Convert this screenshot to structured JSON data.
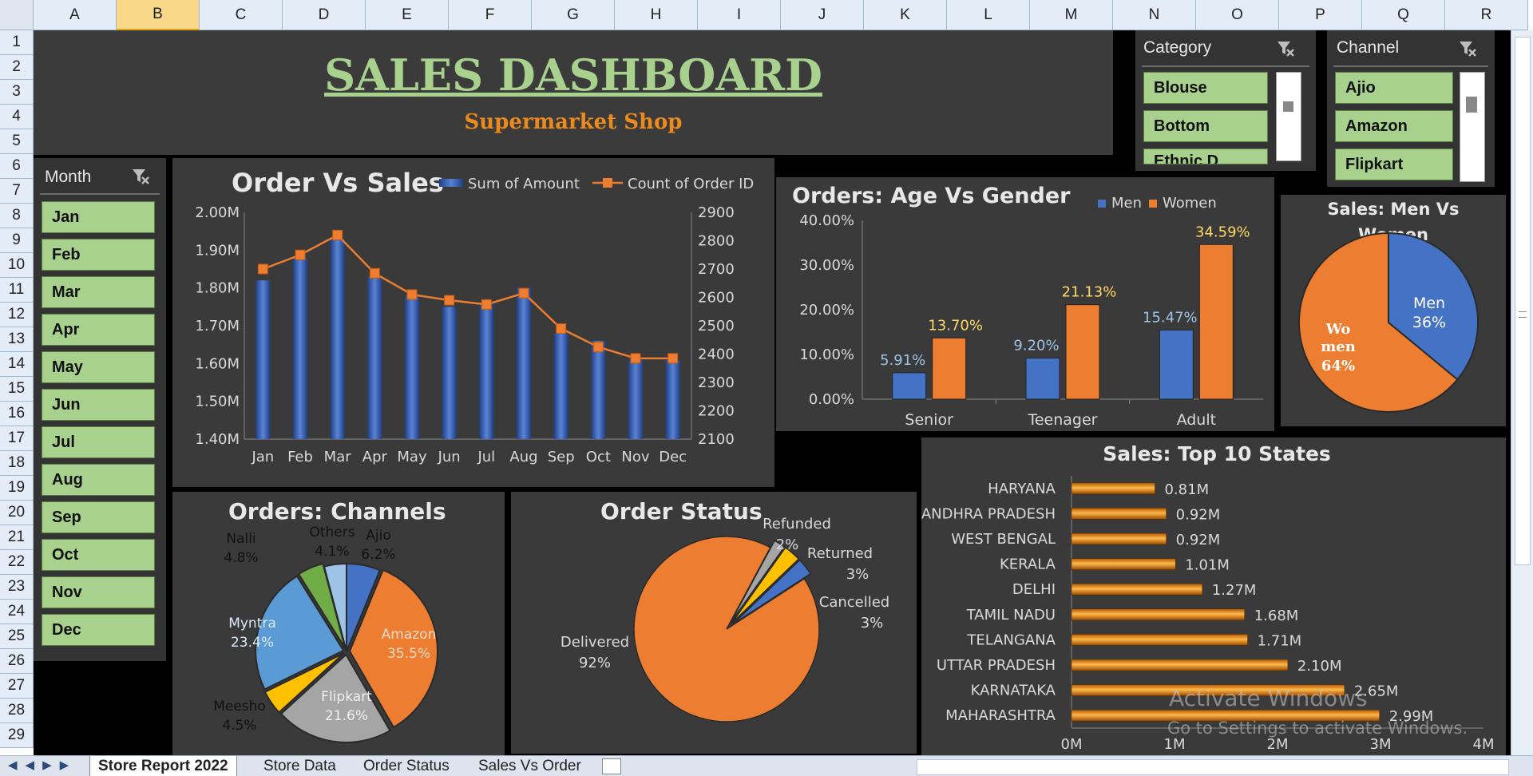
{
  "columns": [
    "A",
    "B",
    "C",
    "D",
    "E",
    "F",
    "G",
    "H",
    "I",
    "J",
    "K",
    "L",
    "M",
    "N",
    "O",
    "P",
    "Q",
    "R"
  ],
  "rows": [
    "1",
    "2",
    "3",
    "4",
    "5",
    "6",
    "7",
    "8",
    "9",
    "10",
    "11",
    "12",
    "13",
    "14",
    "15",
    "16",
    "17",
    "18",
    "19",
    "20",
    "21",
    "22",
    "23",
    "24",
    "25",
    "26",
    "27",
    "28",
    "29"
  ],
  "selected_column": "B",
  "header": {
    "title": "SALES DASHBOARD",
    "subtitle": "Supermarket Shop"
  },
  "slicers": {
    "category": {
      "title": "Category",
      "items": [
        "Blouse",
        "Bottom",
        "Ethnic D"
      ]
    },
    "channel": {
      "title": "Channel",
      "items": [
        "Ajio",
        "Amazon",
        "Flipkart"
      ]
    },
    "month": {
      "title": "Month",
      "items": [
        "Jan",
        "Feb",
        "Mar",
        "Apr",
        "May",
        "Jun",
        "Jul",
        "Aug",
        "Sep",
        "Oct",
        "Nov",
        "Dec"
      ]
    }
  },
  "chart_data": [
    {
      "type": "bar",
      "title": "Order Vs Sales",
      "categories": [
        "Jan",
        "Feb",
        "Mar",
        "Apr",
        "May",
        "Jun",
        "Jul",
        "Aug",
        "Sep",
        "Oct",
        "Nov",
        "Dec"
      ],
      "series": [
        {
          "name": "Sum of Amount",
          "type": "bar",
          "axis": "left",
          "values": [
            1.82,
            1.88,
            1.93,
            1.83,
            1.78,
            1.75,
            1.76,
            1.8,
            1.68,
            1.66,
            1.61,
            1.61
          ]
        },
        {
          "name": "Count of Order ID",
          "type": "line",
          "axis": "right",
          "values": [
            2700,
            2750,
            2820,
            2685,
            2610,
            2590,
            2575,
            2615,
            2490,
            2425,
            2385,
            2385
          ]
        }
      ],
      "yleft_ticks": [
        "2.00M",
        "1.90M",
        "1.80M",
        "1.70M",
        "1.60M",
        "1.50M",
        "1.40M"
      ],
      "yleft_lim": [
        1.4,
        2.0
      ],
      "yright_ticks": [
        "2900",
        "2800",
        "2700",
        "2600",
        "2500",
        "2400",
        "2300",
        "2200",
        "2100"
      ],
      "yright_lim": [
        2100,
        2900
      ],
      "legend": "top-right",
      "colors": {
        "bar": "#3a63b5",
        "line": "#ed7d31"
      }
    },
    {
      "type": "bar",
      "title": "Orders: Age Vs Gender",
      "categories": [
        "Senior",
        "Teenager",
        "Adult"
      ],
      "series": [
        {
          "name": "Men",
          "values": [
            5.91,
            9.2,
            15.47
          ],
          "labels": [
            "5.91%",
            "9.20%",
            "15.47%"
          ]
        },
        {
          "name": "Women",
          "values": [
            13.7,
            21.13,
            34.59
          ],
          "labels": [
            "13.70%",
            "21.13%",
            "34.59%"
          ]
        }
      ],
      "y_ticks": [
        "40.00%",
        "30.00%",
        "20.00%",
        "10.00%",
        "0.00%"
      ],
      "ylim": [
        0,
        40
      ],
      "legend": "top-right",
      "colors": {
        "Men": "#4472c4",
        "Women": "#ed7d31"
      }
    },
    {
      "type": "pie",
      "title": "Sales: Men Vs Women",
      "title_lines": [
        "Sales: Men Vs",
        "Women"
      ],
      "slices": [
        {
          "label": "Men",
          "value": 36,
          "text": "36%",
          "color": "#4472c4"
        },
        {
          "label": "Women",
          "value": 64,
          "text": "64%",
          "label_lines": [
            "Wo",
            "men"
          ],
          "color": "#ed7d31"
        }
      ]
    },
    {
      "type": "pie",
      "title": "Orders: Channels",
      "slices": [
        {
          "label": "Ajio",
          "value": 6.2,
          "text": "6.2%",
          "color": "#4472c4"
        },
        {
          "label": "Amazon",
          "value": 35.5,
          "text": "35.5%",
          "color": "#ed7d31"
        },
        {
          "label": "Flipkart",
          "value": 21.6,
          "text": "21.6%",
          "color": "#a5a5a5"
        },
        {
          "label": "Meesho",
          "value": 4.5,
          "text": "4.5%",
          "color": "#ffc000"
        },
        {
          "label": "Myntra",
          "value": 23.4,
          "text": "23.4%",
          "color": "#5b9bd5"
        },
        {
          "label": "Nalli",
          "value": 4.8,
          "text": "4.8%",
          "color": "#70ad47"
        },
        {
          "label": "Others",
          "value": 4.1,
          "text": "4.1%",
          "color": "#9dc3e6"
        }
      ]
    },
    {
      "type": "pie",
      "title": "Order Status",
      "slices": [
        {
          "label": "Delivered",
          "value": 92,
          "text": "92%",
          "color": "#ed7d31"
        },
        {
          "label": "Refunded",
          "value": 2,
          "text": "2%",
          "color": "#a5a5a5"
        },
        {
          "label": "Returned",
          "value": 3,
          "text": "3%",
          "color": "#ffc000"
        },
        {
          "label": "Cancelled",
          "value": 3,
          "text": "3%",
          "color": "#4472c4"
        }
      ]
    },
    {
      "type": "bar",
      "orientation": "horizontal",
      "title": "Sales: Top 10 States",
      "categories": [
        "HARYANA",
        "ANDHRA PRADESH",
        "WEST BENGAL",
        "KERALA",
        "DELHI",
        "TAMIL NADU",
        "TELANGANA",
        "UTTAR PRADESH",
        "KARNATAKA",
        "MAHARASHTRA"
      ],
      "values": [
        0.81,
        0.92,
        0.92,
        1.01,
        1.27,
        1.68,
        1.71,
        2.1,
        2.65,
        2.99
      ],
      "labels": [
        "0.81M",
        "0.92M",
        "0.92M",
        "1.01M",
        "1.27M",
        "1.68M",
        "1.71M",
        "2.10M",
        "2.65M",
        "2.99M"
      ],
      "x_ticks": [
        "0M",
        "1M",
        "2M",
        "3M",
        "4M"
      ],
      "xlim": [
        0,
        4
      ],
      "color": "#ed9a1c"
    }
  ],
  "sheet_tabs": [
    "Store Report 2022",
    "Store Data",
    "Order Status",
    "Sales Vs Order"
  ],
  "active_tab": "Store Report 2022",
  "watermark": {
    "line1": "Activate Windows",
    "line2": "Go to Settings to activate Windows."
  }
}
